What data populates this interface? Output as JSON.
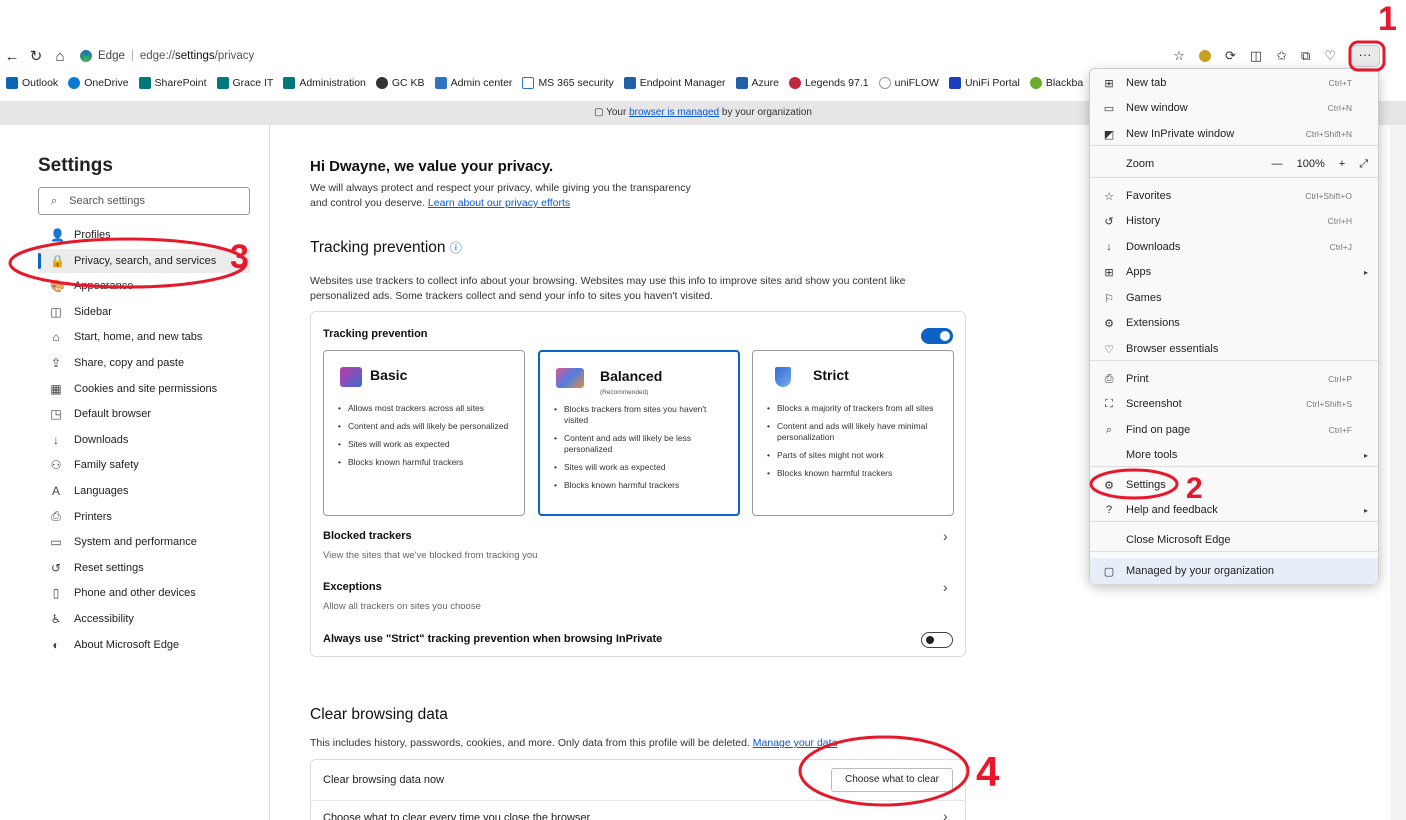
{
  "browser": {
    "edge_label": "Edge",
    "url_prefix": "edge://",
    "url_bold": "settings",
    "url_rest": "/privacy",
    "more_label": "···"
  },
  "favorites": [
    "Outlook",
    "OneDrive",
    "SharePoint",
    "Grace IT",
    "Administration",
    "GC KB",
    "Admin center",
    "MS 365 security",
    "Endpoint Manager",
    "Azure",
    "Legends 97.1",
    "uniFLOW",
    "UniFi Portal",
    "Blackba"
  ],
  "banner": {
    "pre": "Your",
    "link": "browser is managed",
    "post": "by your organization"
  },
  "sidebar": {
    "title": "Settings",
    "search_placeholder": "Search settings",
    "items": [
      {
        "label": "Profiles",
        "icon": "👤"
      },
      {
        "label": "Privacy, search, and services",
        "icon": "🔒"
      },
      {
        "label": "Appearance",
        "icon": "🎨"
      },
      {
        "label": "Sidebar",
        "icon": "◫"
      },
      {
        "label": "Start, home, and new tabs",
        "icon": "⌂"
      },
      {
        "label": "Share, copy and paste",
        "icon": "⇪"
      },
      {
        "label": "Cookies and site permissions",
        "icon": "▦"
      },
      {
        "label": "Default browser",
        "icon": "◳"
      },
      {
        "label": "Downloads",
        "icon": "↓"
      },
      {
        "label": "Family safety",
        "icon": "⚇"
      },
      {
        "label": "Languages",
        "icon": "A"
      },
      {
        "label": "Printers",
        "icon": "⎙"
      },
      {
        "label": "System and performance",
        "icon": "▭"
      },
      {
        "label": "Reset settings",
        "icon": "↺"
      },
      {
        "label": "Phone and other devices",
        "icon": "▯"
      },
      {
        "label": "Accessibility",
        "icon": "♿"
      },
      {
        "label": "About Microsoft Edge",
        "icon": "◐"
      }
    ]
  },
  "main": {
    "greeting": "Hi Dwayne, we value your privacy.",
    "intro_line1": "We will always protect and respect your privacy, while giving you the transparency",
    "intro_line2": "and control you deserve.",
    "intro_link": "Learn about our privacy efforts",
    "tracking_title": "Tracking prevention",
    "tracking_desc1": "Websites use trackers to collect info about your browsing. Websites may use this info to improve sites and show you content like",
    "tracking_desc2": "personalized ads. Some trackers collect and send your info to sites you haven't visited.",
    "tp_label": "Tracking prevention",
    "modes": [
      {
        "title": "Basic",
        "rec": "",
        "bullets": [
          "Allows most trackers across all sites",
          "Content and ads will likely be personalized",
          "Sites will work as expected",
          "Blocks known harmful trackers"
        ]
      },
      {
        "title": "Balanced",
        "rec": "(Recommended)",
        "bullets": [
          "Blocks trackers from sites you haven't visited",
          "Content and ads will likely be less personalized",
          "Sites will work as expected",
          "Blocks known harmful trackers"
        ]
      },
      {
        "title": "Strict",
        "rec": "",
        "bullets": [
          "Blocks a majority of trackers from all sites",
          "Content and ads will likely have minimal personalization",
          "Parts of sites might not work",
          "Blocks known harmful trackers"
        ]
      }
    ],
    "blocked_label": "Blocked trackers",
    "blocked_sub": "View the sites that we've blocked from tracking you",
    "exceptions_label": "Exceptions",
    "exceptions_sub": "Allow all trackers on sites you choose",
    "strict_inprivate": "Always use \"Strict\" tracking prevention when browsing InPrivate",
    "clear_title": "Clear browsing data",
    "clear_desc": "This includes history, passwords, cookies, and more. Only data from this profile will be deleted.",
    "clear_link": "Manage your data",
    "clear_now": "Clear browsing data now",
    "choose_btn": "Choose what to clear",
    "clear_every": "Choose what to clear every time you close the browser"
  },
  "menu": {
    "items": [
      {
        "label": "New tab",
        "shortcut": "Ctrl+T",
        "icon": "⊞"
      },
      {
        "label": "New window",
        "shortcut": "Ctrl+N",
        "icon": "▭"
      },
      {
        "label": "New InPrivate window",
        "shortcut": "Ctrl+Shift+N",
        "icon": "◩"
      },
      {
        "label": "Zoom",
        "shortcut": "",
        "icon": ""
      },
      {
        "label": "Favorites",
        "shortcut": "Ctrl+Shift+O",
        "icon": "☆"
      },
      {
        "label": "History",
        "shortcut": "Ctrl+H",
        "icon": "↺"
      },
      {
        "label": "Downloads",
        "shortcut": "Ctrl+J",
        "icon": "↓"
      },
      {
        "label": "Apps",
        "shortcut": "",
        "icon": "⊞"
      },
      {
        "label": "Games",
        "shortcut": "",
        "icon": "⚐"
      },
      {
        "label": "Extensions",
        "shortcut": "",
        "icon": "⚙"
      },
      {
        "label": "Browser essentials",
        "shortcut": "",
        "icon": "♡"
      },
      {
        "label": "Print",
        "shortcut": "Ctrl+P",
        "icon": "⎙"
      },
      {
        "label": "Screenshot",
        "shortcut": "Ctrl+Shift+S",
        "icon": "⛶"
      },
      {
        "label": "Find on page",
        "shortcut": "Ctrl+F",
        "icon": "⌕"
      },
      {
        "label": "More tools",
        "shortcut": "",
        "icon": ""
      },
      {
        "label": "Settings",
        "shortcut": "",
        "icon": "⚙"
      },
      {
        "label": "Help and feedback",
        "shortcut": "",
        "icon": "?"
      },
      {
        "label": "Close Microsoft Edge",
        "shortcut": "",
        "icon": ""
      },
      {
        "label": "Managed by your organization",
        "shortcut": "",
        "icon": "▢"
      }
    ],
    "zoom_minus": "—",
    "zoom_value": "100%",
    "zoom_plus": "+",
    "zoom_expand": "⤢"
  },
  "annotations": {
    "n1": "1",
    "n2": "2",
    "n3": "3",
    "n4": "4",
    "color": "#e8182c"
  }
}
